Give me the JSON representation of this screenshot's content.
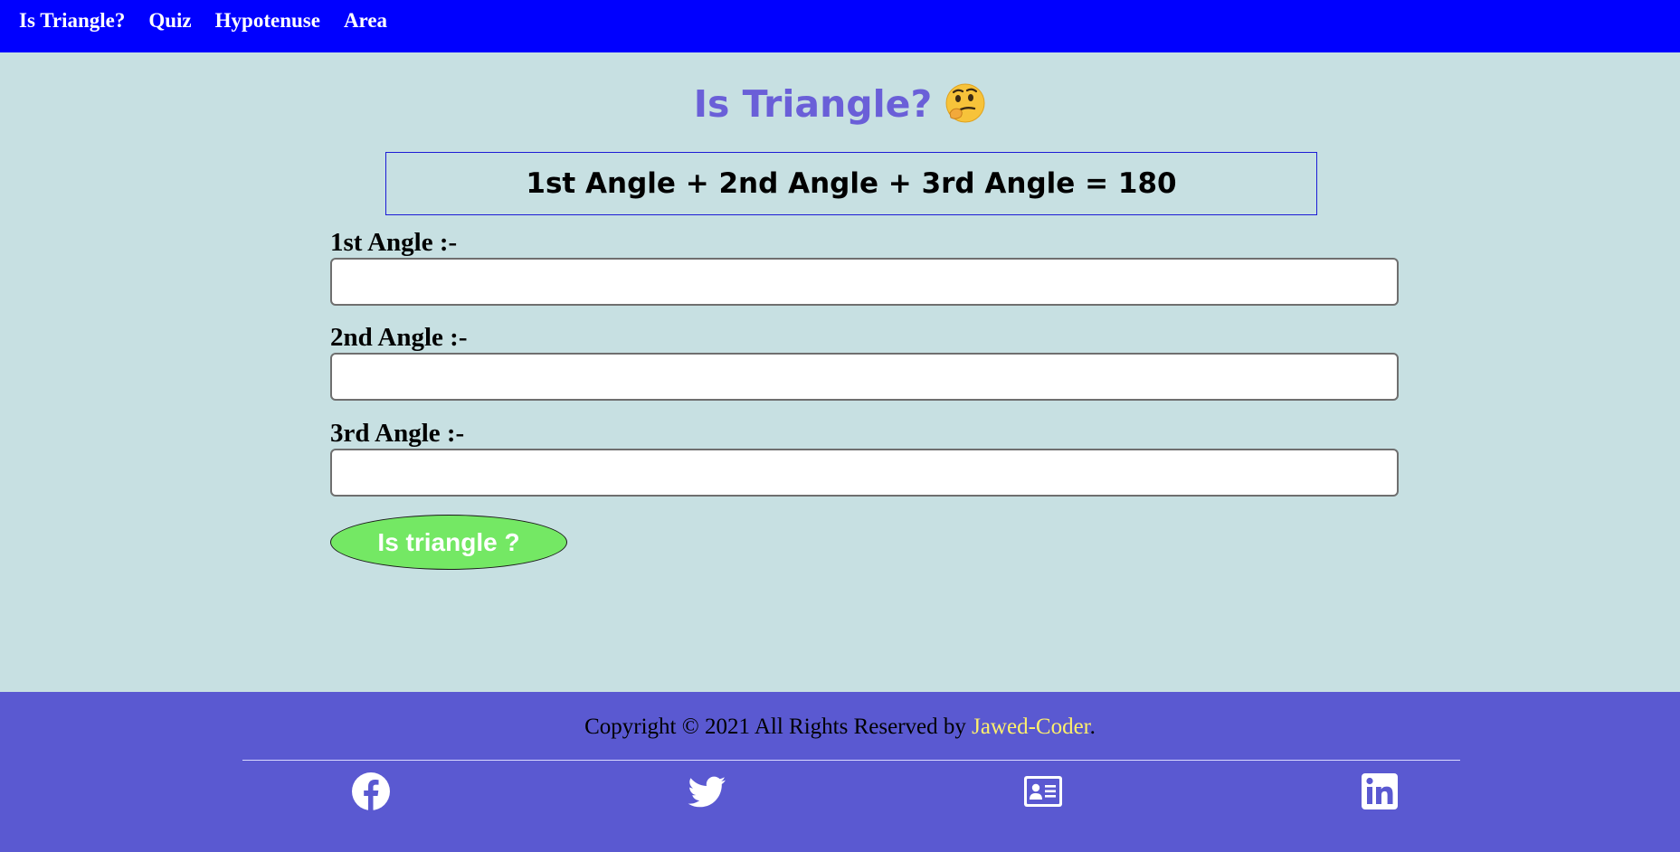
{
  "nav": {
    "items": [
      {
        "label": "Is Triangle?"
      },
      {
        "label": "Quiz"
      },
      {
        "label": "Hypotenuse"
      },
      {
        "label": "Area"
      }
    ]
  },
  "main": {
    "title": "Is Triangle?",
    "title_emoji": "thinking-face-icon",
    "formula": "1st Angle + 2nd Angle + 3rd Angle = 180",
    "fields": [
      {
        "label": "1st Angle :-",
        "value": "",
        "placeholder": ""
      },
      {
        "label": "2nd Angle :-",
        "value": "",
        "placeholder": ""
      },
      {
        "label": "3rd Angle :-",
        "value": "",
        "placeholder": ""
      }
    ],
    "button_label": "Is triangle ?"
  },
  "footer": {
    "copyright_prefix": "Copyright © 2021 All Rights Reserved by",
    "author": "Jawed-Coder",
    "suffix": ".",
    "social": [
      "facebook-icon",
      "twitter-icon",
      "contact-card-icon",
      "linkedin-icon"
    ]
  },
  "colors": {
    "navbar": "#0000ff",
    "background": "#c7e0e2",
    "title": "#6a5fd8",
    "button": "#74e864",
    "footer": "#5a59d1",
    "author_link": "#fff06b"
  }
}
